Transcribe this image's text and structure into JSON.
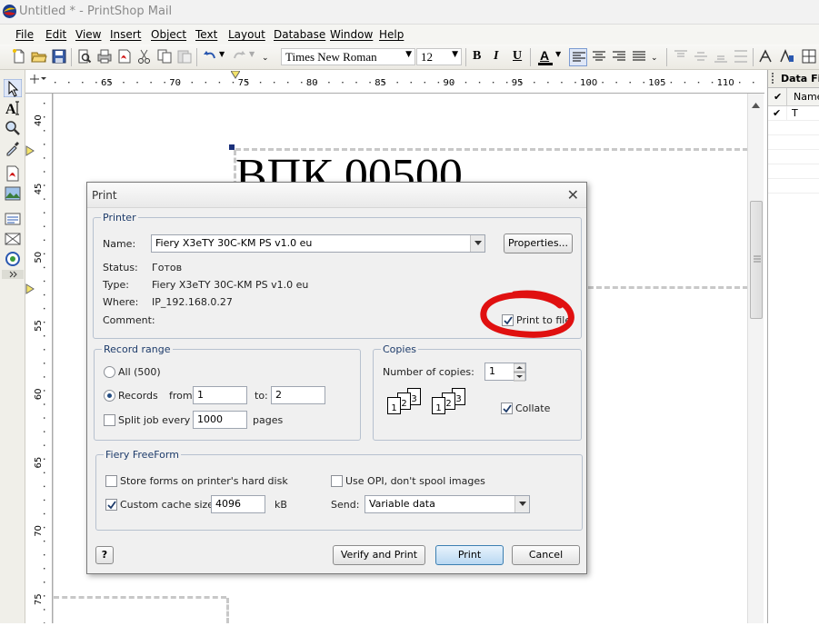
{
  "window": {
    "title": "Untitled * - PrintShop Mail"
  },
  "menu": [
    "File",
    "Edit",
    "View",
    "Insert",
    "Object",
    "Text",
    "Layout",
    "Database",
    "Window",
    "Help"
  ],
  "toolbar": {
    "font_name": "Times New Roman",
    "font_size": "12",
    "bold": "B",
    "italic": "I",
    "underline": "U",
    "font_color": "A"
  },
  "ruler": {
    "h_labels": [
      "65",
      "70",
      "75",
      "80",
      "85",
      "90",
      "95",
      "100",
      "105",
      "110"
    ],
    "v_labels": [
      "40",
      "45",
      "50",
      "55",
      "60",
      "65",
      "70",
      "75"
    ]
  },
  "document": {
    "text": "ВПК 00500"
  },
  "data_panel": {
    "title": "Data Fie",
    "column": "Name",
    "rows": [
      {
        "checked": true,
        "name": "T"
      }
    ]
  },
  "print_dialog": {
    "title": "Print",
    "printer_group": "Printer",
    "name_label": "Name:",
    "name_value": "Fiery X3eTY 30C-KM PS v1.0 eu",
    "properties_button": "Properties...",
    "status_label": "Status:",
    "status_value": "Готов",
    "type_label": "Type:",
    "type_value": "Fiery X3eTY 30C-KM PS v1.0 eu",
    "where_label": "Where:",
    "where_value": "IP_192.168.0.27",
    "comment_label": "Comment:",
    "print_to_file_label": "Print to file",
    "print_to_file_checked": true,
    "record_range_group": "Record range",
    "all_label": "All (500)",
    "records_label": "Records",
    "records_selected": true,
    "from_label": "from:",
    "from_value": "1",
    "to_label": "to:",
    "to_value": "2",
    "split_job_label": "Split job every",
    "split_job_value": "1000",
    "pages_label": "pages",
    "copies_group": "Copies",
    "number_of_copies_label": "Number of copies:",
    "number_of_copies_value": "1",
    "collate_label": "Collate",
    "collate_checked": true,
    "collate_pages": [
      "1",
      "2",
      "3"
    ],
    "fiery_group": "Fiery FreeForm",
    "store_forms_label": "Store forms on printer's hard disk",
    "store_forms_checked": false,
    "use_opi_label": "Use OPI, don't spool images",
    "use_opi_checked": false,
    "custom_cache_label": "Custom cache size:",
    "custom_cache_checked": true,
    "custom_cache_value": "4096",
    "custom_cache_unit": "kB",
    "send_label": "Send:",
    "send_value": "Variable data",
    "help_button": "?",
    "verify_print_button": "Verify and Print",
    "print_button": "Print",
    "cancel_button": "Cancel"
  },
  "colors": {
    "annotation_red": "#e01010",
    "group_title_blue": "#1d3b6a",
    "default_button_border": "#3c7fb1"
  }
}
